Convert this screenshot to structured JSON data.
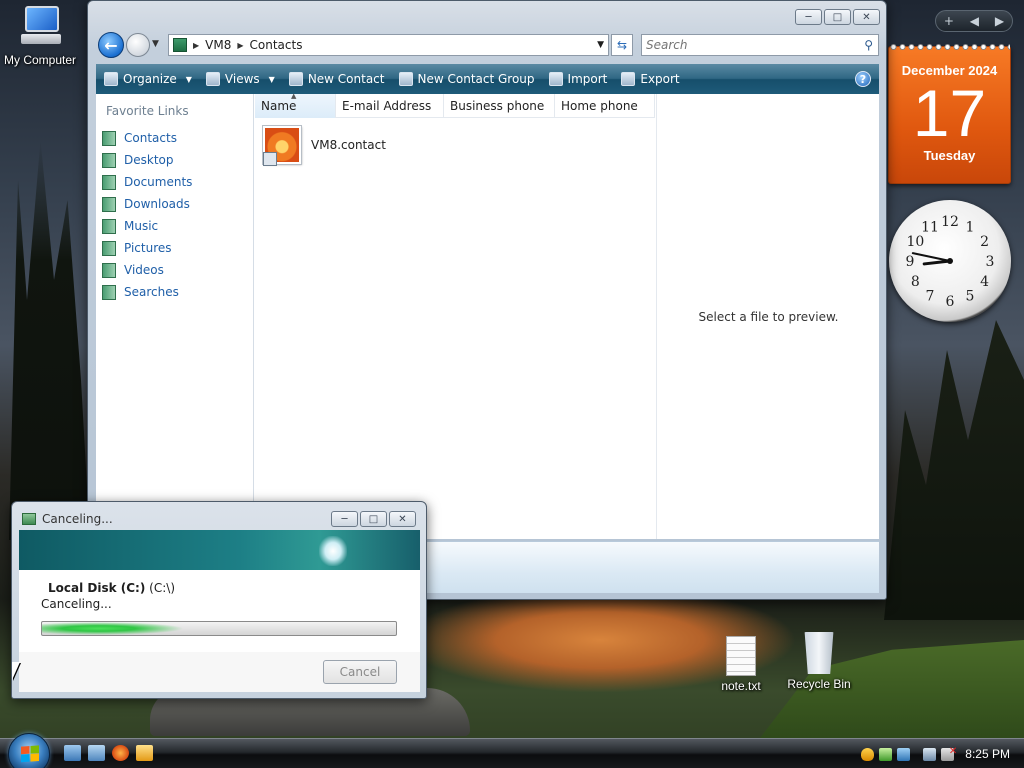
{
  "desktop": {
    "icons": {
      "my_computer": "My Computer",
      "note": "note.txt",
      "recycle_bin": "Recycle Bin"
    }
  },
  "gadgets": {
    "calendar": {
      "month_year": "December 2024",
      "day": "17",
      "weekday": "Tuesday"
    },
    "clock": {
      "hour": 8,
      "minute": 47,
      "numerals": [
        "12",
        "1",
        "2",
        "3",
        "4",
        "5",
        "6",
        "7",
        "8",
        "9",
        "10",
        "11"
      ]
    }
  },
  "explorer": {
    "address": {
      "crumbs": [
        "VM8",
        "Contacts"
      ]
    },
    "search": {
      "placeholder": "Search"
    },
    "toolbar": {
      "organize": "Organize",
      "views": "Views",
      "new_contact": "New Contact",
      "new_contact_group": "New Contact Group",
      "import": "Import",
      "export": "Export",
      "help": "?"
    },
    "favorites": {
      "title": "Favorite Links",
      "items": [
        "Contacts",
        "Desktop",
        "Documents",
        "Downloads",
        "Music",
        "Pictures",
        "Videos",
        "Searches"
      ]
    },
    "columns": [
      "Name",
      "E-mail Address",
      "Business phone",
      "Home phone"
    ],
    "files": [
      {
        "name": "VM8.contact"
      }
    ],
    "preview_message": "Select a file to preview."
  },
  "cancel_dialog": {
    "title": "Canceling...",
    "disk_label": "Local Disk (C:)",
    "disk_path": "(C:\\)",
    "status": "Canceling...",
    "cancel_button": "Cancel",
    "progress": 0.4
  },
  "taskbar": {
    "time": "8:25 PM"
  },
  "colors": {
    "calendar": "#e0580f",
    "toolbar": "#1e5b79",
    "link": "#1f5fa8",
    "progress": "#2fc544"
  }
}
